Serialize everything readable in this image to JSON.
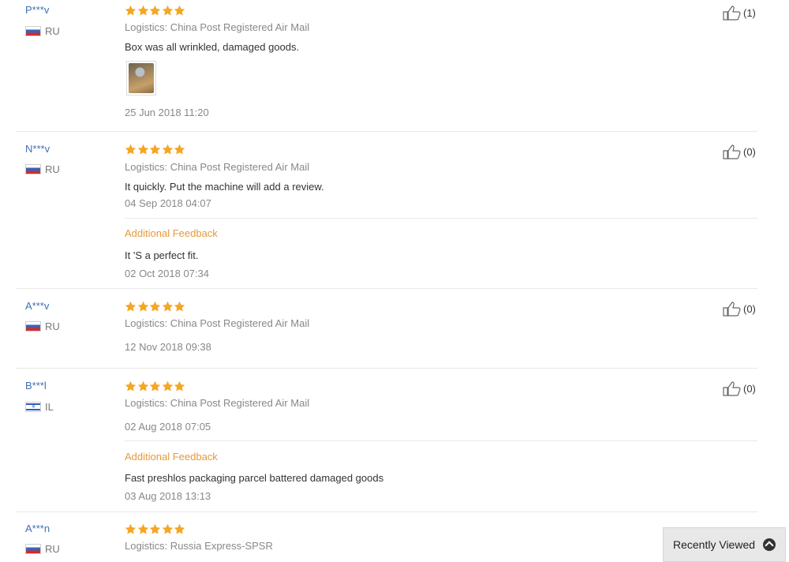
{
  "colors": {
    "username": "#3f71b6",
    "star": "#f5a623",
    "additional_feedback": "#e59a3c",
    "meta": "#888888"
  },
  "reviews": [
    {
      "user": "P***v",
      "country": "RU",
      "flag": "ru-flag-icon",
      "stars": 5,
      "logistics": "Logistics: China Post Registered Air Mail",
      "comment": "Box was all wrinkled, damaged goods.",
      "has_photo": true,
      "date": "25 Jun 2018 11:20",
      "helpful": "(1)"
    },
    {
      "user": "N***v",
      "country": "RU",
      "flag": "ru-flag-icon",
      "stars": 5,
      "logistics": "Logistics: China Post Registered Air Mail",
      "comment": "It quickly. Put the machine will add a review.",
      "date": "04 Sep 2018 04:07",
      "additional_label": "Additional Feedback",
      "additional_comment": "It 'S a perfect fit.",
      "additional_date": "02 Oct 2018 07:34",
      "helpful": "(0)"
    },
    {
      "user": "A***v",
      "country": "RU",
      "flag": "ru-flag-icon",
      "stars": 5,
      "logistics": "Logistics: China Post Registered Air Mail",
      "date": "12 Nov 2018 09:38",
      "helpful": "(0)"
    },
    {
      "user": "B***l",
      "country": "IL",
      "flag": "il-flag-icon",
      "stars": 5,
      "logistics": "Logistics: China Post Registered Air Mail",
      "date": "02 Aug 2018 07:05",
      "additional_label": "Additional Feedback",
      "additional_comment": "Fast preshlos packaging parcel battered damaged goods",
      "additional_date": "03 Aug 2018 13:13",
      "helpful": "(0)"
    },
    {
      "user": "A***n",
      "country": "RU",
      "flag": "ru-flag-icon",
      "stars": 5,
      "logistics": "Logistics: Russia Express-SPSR"
    }
  ],
  "recently_viewed": {
    "label": "Recently Viewed",
    "icon": "chevron-up-icon"
  }
}
